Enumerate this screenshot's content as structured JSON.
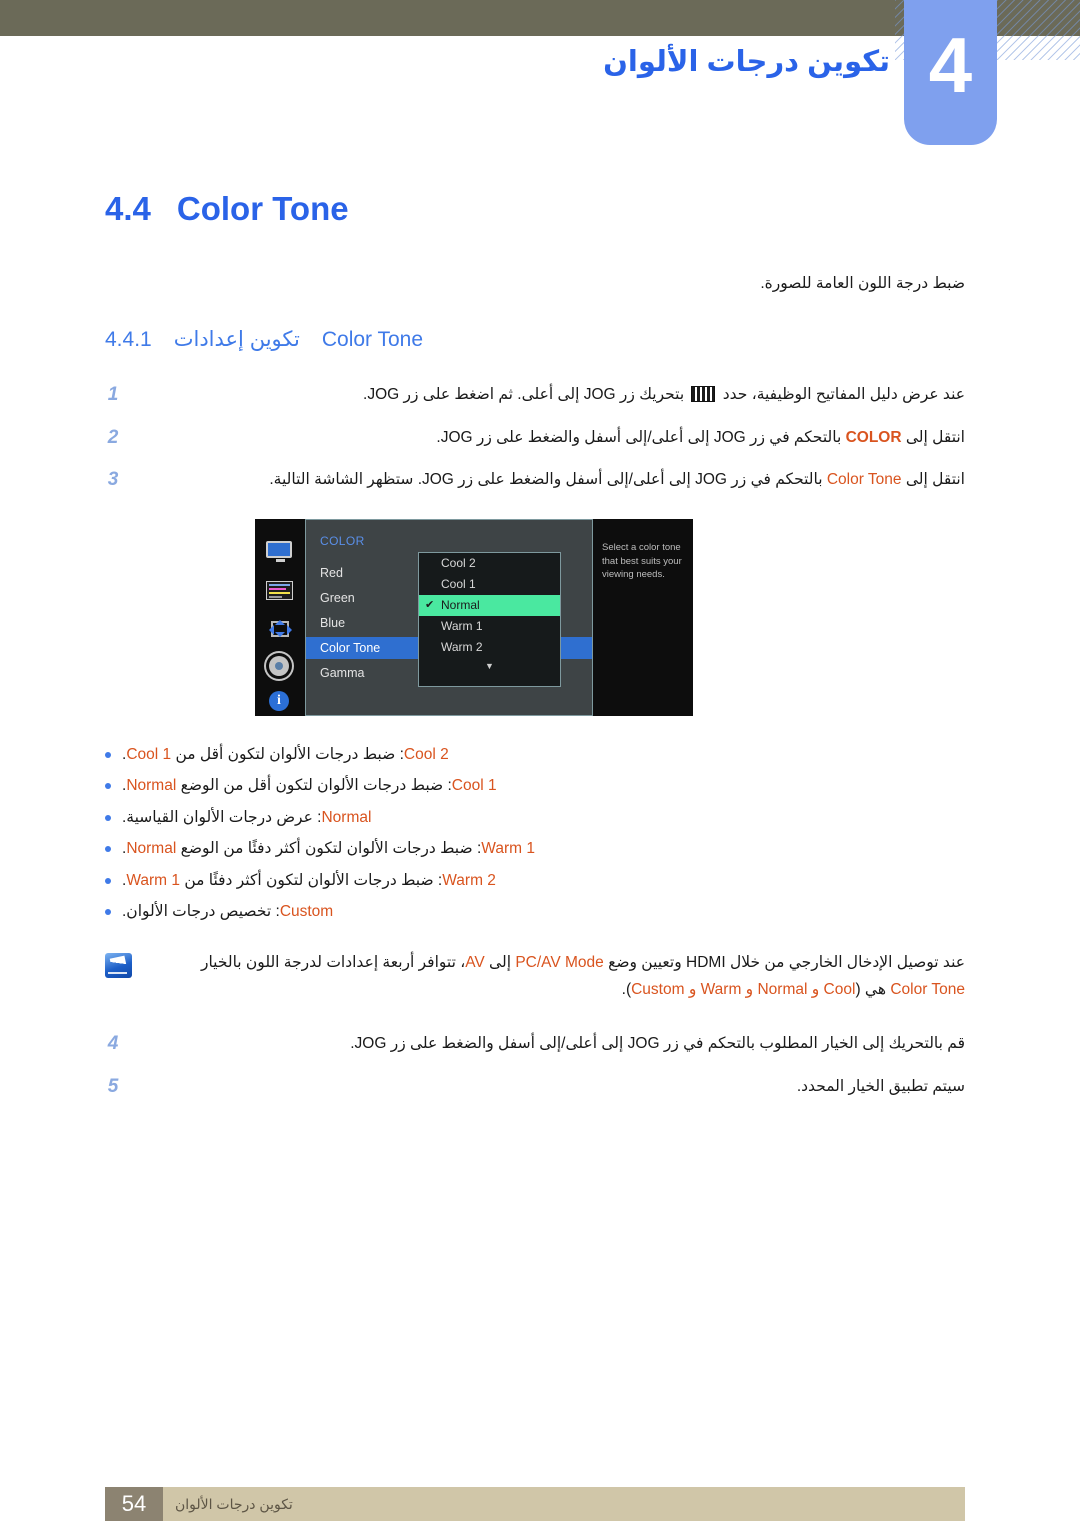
{
  "header": {
    "chapter_number": "4",
    "chapter_title": "تكوين درجات الألوان"
  },
  "section": {
    "number": "4.4",
    "title": "Color Tone",
    "intro": "ضبط درجة اللون العامة للصورة."
  },
  "subsection": {
    "number": "4.4.1",
    "title_ar": "تكوين إعدادات",
    "title_en": "Color Tone"
  },
  "steps": [
    {
      "index": "1",
      "pre": "عند عرض دليل المفاتيح الوظيفية، حدد",
      "icon": "function-key-guide-icon",
      "post": "بتحريك زر JOG إلى أعلى. ثم اضغط على زر JOG."
    },
    {
      "index": "2",
      "pre": "انتقل إلى",
      "keyword": "COLOR",
      "post": "بالتحكم في زر JOG إلى أعلى/إلى أسفل والضغط على زر JOG."
    },
    {
      "index": "3",
      "pre": "انتقل إلى",
      "keyword": "Color Tone",
      "post": "بالتحكم في زر JOG إلى أعلى/إلى أسفل والضغط على زر JOG. ستظهر الشاشة التالية."
    }
  ],
  "steps_tail": [
    {
      "index": "4",
      "text": "قم بالتحريك إلى الخيار المطلوب بالتحكم في زر JOG إلى أعلى/إلى أسفل والضغط على زر JOG."
    },
    {
      "index": "5",
      "text": "سيتم تطبيق الخيار المحدد."
    }
  ],
  "osd": {
    "category": "COLOR",
    "menu_items": [
      "Red",
      "Green",
      "Blue",
      "Color Tone",
      "Gamma"
    ],
    "selected_menu_item": "Color Tone",
    "help_text": "Select a color tone that best suits your viewing needs.",
    "options": [
      "Cool 2",
      "Cool 1",
      "Normal",
      "Warm 1",
      "Warm 2"
    ],
    "selected_option": "Normal",
    "scroll_caret": "▼",
    "rail_icons": [
      "monitor-icon",
      "color-bars-icon",
      "size-position-icon",
      "settings-gear-icon",
      "information-icon"
    ],
    "colors": {
      "menu_highlight": "#2f6fd0",
      "option_highlight": "#4ae8a0",
      "category_label": "#5a8fe8",
      "panel_bg": "#3e4446",
      "rail_bg": "#0d0d0d"
    }
  },
  "bullets": [
    {
      "term": "Cool 2",
      "desc_pre": ": ضبط درجات الألوان لتكون أقل من",
      "term2": "Cool 1",
      "desc_post": "."
    },
    {
      "term": "Cool 1",
      "desc_pre": ": ضبط درجات الألوان لتكون أقل من الوضع",
      "term2": "Normal",
      "desc_post": "."
    },
    {
      "term": "Normal",
      "desc_pre": ": عرض درجات الألوان القياسية.",
      "term2": "",
      "desc_post": ""
    },
    {
      "term": "Warm 1",
      "desc_pre": ": ضبط درجات الألوان لتكون أكثر دفئًا من الوضع",
      "term2": "Normal",
      "desc_post": "."
    },
    {
      "term": "Warm 2",
      "desc_pre": ": ضبط درجات الألوان لتكون أكثر دفئًا من",
      "term2": "Warm 1",
      "desc_post": "."
    },
    {
      "term": "Custom",
      "desc_pre": ": تخصيص درجات الألوان.",
      "term2": "",
      "desc_post": ""
    }
  ],
  "note": {
    "icon": "note-pen-icon",
    "line1_a": "عند توصيل الإدخال الخارجي من خلال HDMI وتعيين وضع",
    "line1_kw1": "PC/AV Mode",
    "line1_b": "إلى",
    "line1_kw2": "AV",
    "line1_c": "، تتوافر أربعة إعدادات لدرجة اللون بالخيار",
    "line2_kw": "Color Tone",
    "line2_mid": "هي (",
    "line2_opts": "Cool و Normal و Warm و Custom",
    "line2_end": ")."
  },
  "footer": {
    "page_number": "54",
    "text": "تكوين درجات الألوان"
  }
}
